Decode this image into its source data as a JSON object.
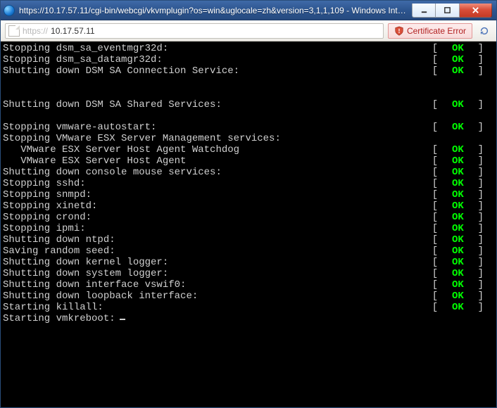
{
  "window": {
    "title": "https://10.17.57.11/cgi-bin/webcgi/vkvmplugin?os=win&uglocale=zh&version=3,1,1,109 - Windows Inte..."
  },
  "addressbar": {
    "scheme": "https://",
    "host": "10.17.57.11",
    "cert_error_label": "Certificate Error"
  },
  "terminal": {
    "status_ok": "OK",
    "cursor": true,
    "lines": [
      {
        "text": "Stopping dsm_sa_eventmgr32d:",
        "status": "OK"
      },
      {
        "text": "Stopping dsm_sa_datamgr32d:",
        "status": "OK"
      },
      {
        "text": "Shutting down DSM SA Connection Service:",
        "status": "OK"
      },
      {
        "text": ""
      },
      {
        "text": ""
      },
      {
        "text": "Shutting down DSM SA Shared Services:",
        "status": "OK"
      },
      {
        "text": ""
      },
      {
        "text": "Stopping vmware-autostart:",
        "status": "OK"
      },
      {
        "text": "Stopping VMware ESX Server Management services:"
      },
      {
        "text": "   VMware ESX Server Host Agent Watchdog",
        "status": "OK"
      },
      {
        "text": "   VMware ESX Server Host Agent",
        "status": "OK"
      },
      {
        "text": "Shutting down console mouse services:",
        "status": "OK"
      },
      {
        "text": "Stopping sshd:",
        "status": "OK"
      },
      {
        "text": "Stopping snmpd:",
        "status": "OK"
      },
      {
        "text": "Stopping xinetd:",
        "status": "OK"
      },
      {
        "text": "Stopping crond:",
        "status": "OK"
      },
      {
        "text": "Stopping ipmi:",
        "status": "OK"
      },
      {
        "text": "Shutting down ntpd:",
        "status": "OK"
      },
      {
        "text": "Saving random seed:",
        "status": "OK"
      },
      {
        "text": "Shutting down kernel logger:",
        "status": "OK"
      },
      {
        "text": "Shutting down system logger:",
        "status": "OK"
      },
      {
        "text": "Shutting down interface vswif0:",
        "status": "OK"
      },
      {
        "text": "Shutting down loopback interface:",
        "status": "OK"
      },
      {
        "text": "Starting killall:",
        "status": "OK"
      },
      {
        "text": "Starting vmkreboot:",
        "cursor": true
      }
    ]
  }
}
